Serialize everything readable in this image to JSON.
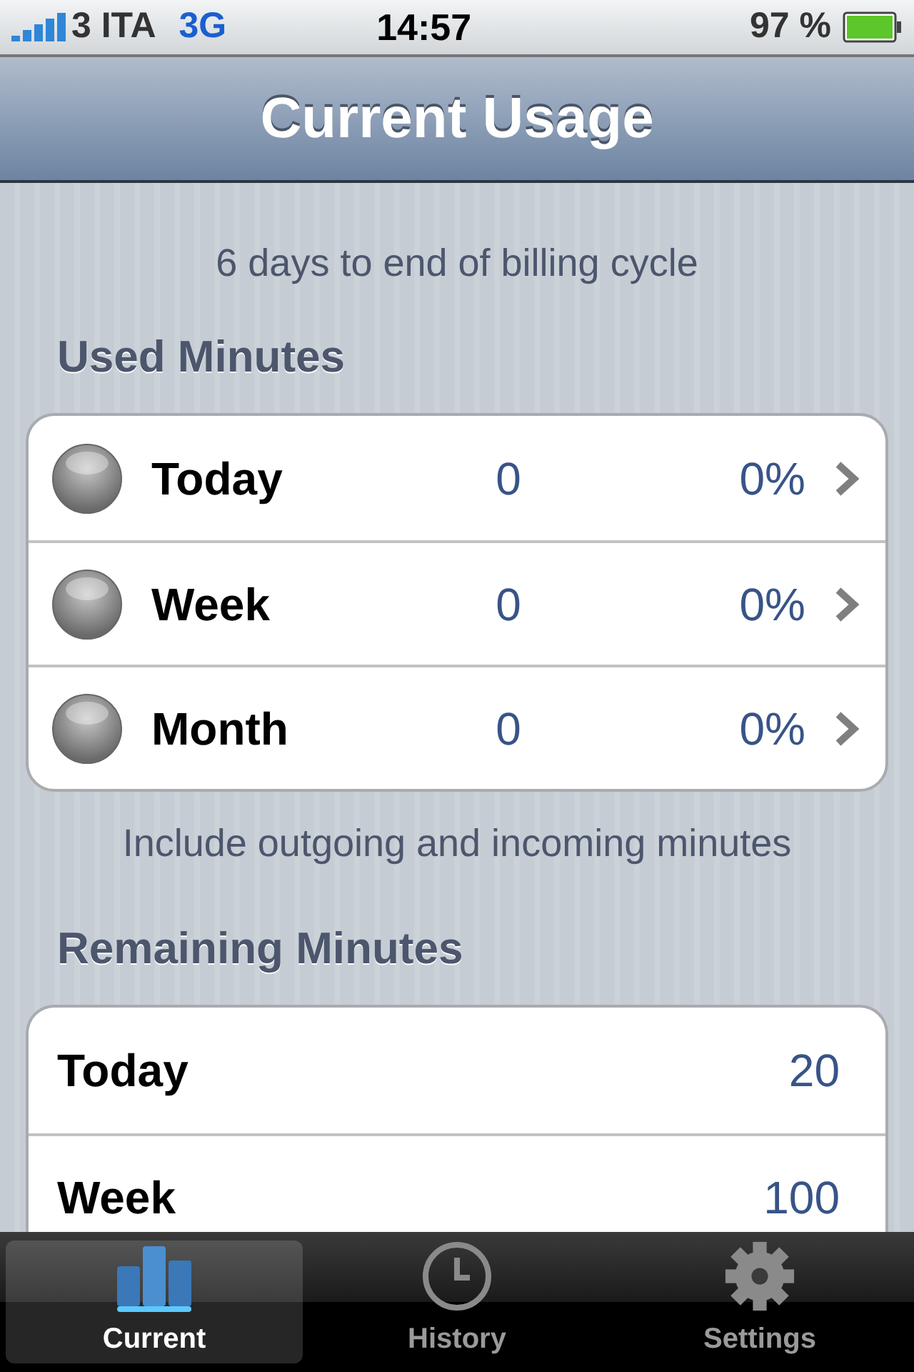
{
  "status_bar": {
    "carrier": "3 ITA",
    "network": "3G",
    "time": "14:57",
    "battery": "97 %"
  },
  "nav_bar": {
    "title": "Current Usage"
  },
  "billing_note": "6 days to end of billing cycle",
  "used_minutes": {
    "header": "Used Minutes",
    "rows": [
      {
        "label": "Today",
        "minutes": "0",
        "percent": "0%"
      },
      {
        "label": "Week",
        "minutes": "0",
        "percent": "0%"
      },
      {
        "label": "Month",
        "minutes": "0",
        "percent": "0%"
      }
    ],
    "footer": "Include outgoing and incoming minutes"
  },
  "remaining_minutes": {
    "header": "Remaining Minutes",
    "rows": [
      {
        "label": "Today",
        "value": "20"
      },
      {
        "label": "Week",
        "value": "100"
      }
    ]
  },
  "tab_bar": [
    {
      "label": "Current",
      "kind": "chart",
      "selected": true
    },
    {
      "label": "History",
      "kind": "clock",
      "selected": false
    },
    {
      "label": "Settings",
      "kind": "gear",
      "selected": false
    }
  ]
}
